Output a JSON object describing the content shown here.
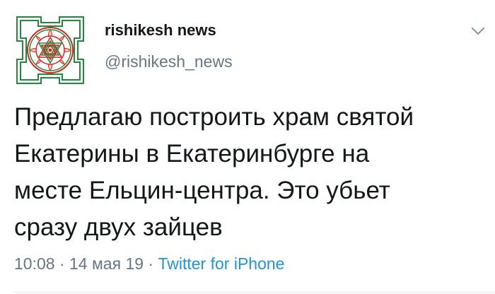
{
  "header": {
    "display_name": "rishikesh news",
    "handle": "@rishikesh_news",
    "avatar_icon": "sri-yantra-icon",
    "menu_icon": "chevron-down-icon"
  },
  "tweet": {
    "lines": [
      "Предлагаю построить храм святой",
      "Екатерины в Екатеринбурге на",
      "месте Ельцин-центра. Это убьет",
      "сразу двух зайцев"
    ]
  },
  "meta": {
    "time": "10:08",
    "separator": "·",
    "date": "14 мая 19",
    "source": "Twitter for iPhone"
  },
  "colors": {
    "text": "#14171a",
    "muted": "#657786",
    "link": "#1b95e0",
    "avatar_red": "#d6261f",
    "avatar_green": "#1f8a3c"
  }
}
